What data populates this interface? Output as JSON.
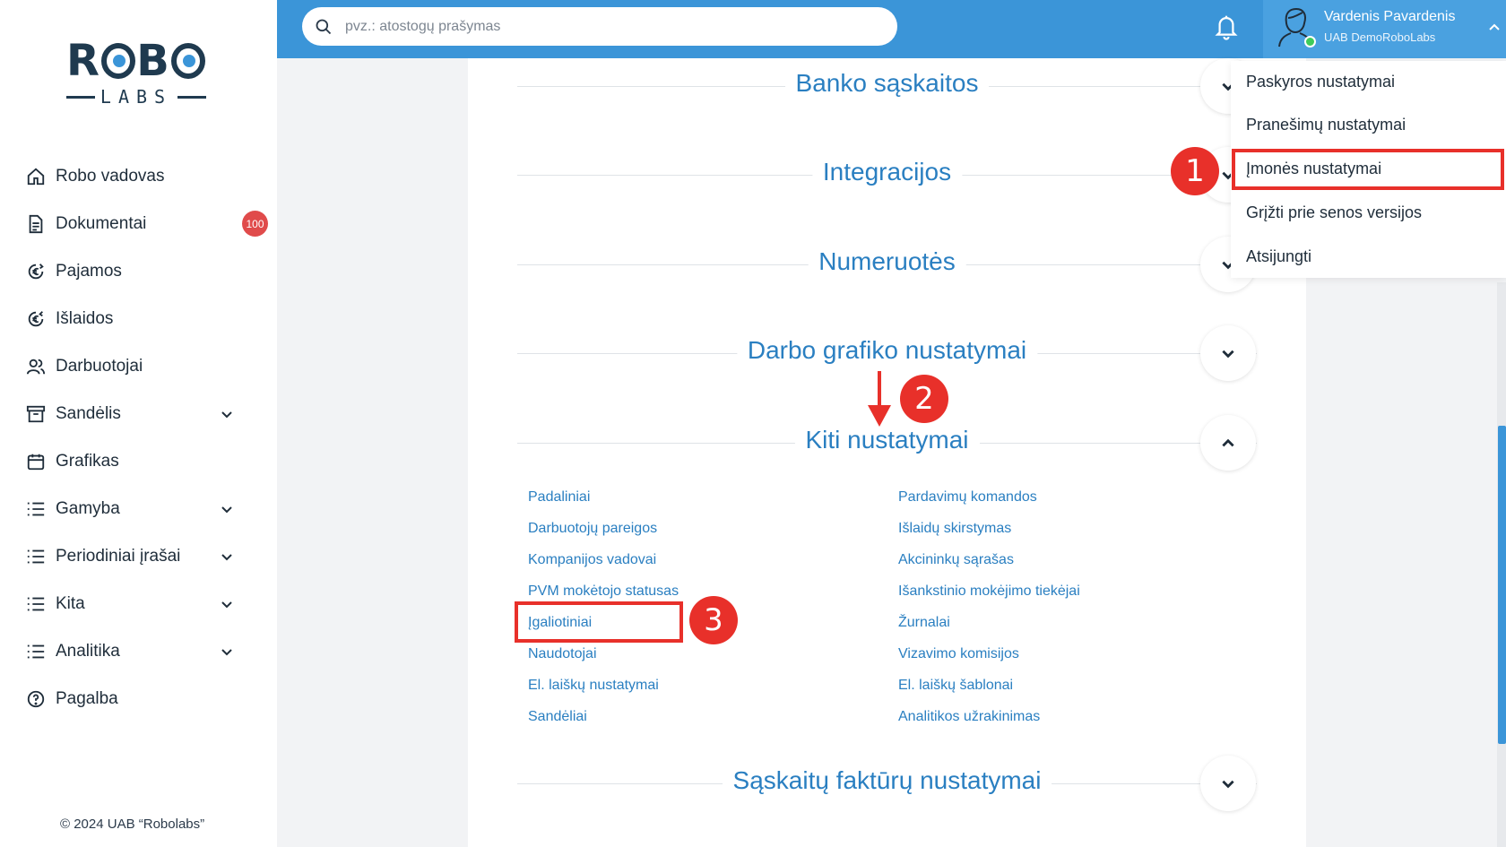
{
  "brand": {
    "logo_top_left": "R",
    "logo_top_mid": "B",
    "logo_bottom": "LABS"
  },
  "sidebar": {
    "items": [
      {
        "label": "Robo vadovas",
        "icon": "home-icon",
        "has_chevron": false
      },
      {
        "label": "Dokumentai",
        "icon": "document-icon",
        "badge": "100"
      },
      {
        "label": "Pajamos",
        "icon": "income-icon"
      },
      {
        "label": "Išlaidos",
        "icon": "expense-icon"
      },
      {
        "label": "Darbuotojai",
        "icon": "users-icon"
      },
      {
        "label": "Sandėlis",
        "icon": "archive-icon",
        "has_chevron": true
      },
      {
        "label": "Grafikas",
        "icon": "calendar-icon"
      },
      {
        "label": "Gamyba",
        "icon": "list-icon",
        "has_chevron": true
      },
      {
        "label": "Periodiniai įrašai",
        "icon": "list-icon",
        "has_chevron": true
      },
      {
        "label": "Kita",
        "icon": "list-icon",
        "has_chevron": true
      },
      {
        "label": "Analitika",
        "icon": "list-icon",
        "has_chevron": true
      },
      {
        "label": "Pagalba",
        "icon": "help-icon"
      }
    ],
    "copyright": "© 2024 UAB “Robolabs”"
  },
  "topbar": {
    "search_placeholder": "pvz.: atostogų prašymas",
    "user_name": "Vardenis Pavardenis",
    "user_company": "UAB DemoRoboLabs"
  },
  "dropdown": {
    "items": [
      "Paskyros nustatymai",
      "Pranešimų nustatymai",
      "Įmonės nustatymai",
      "Grįžti prie senos versijos",
      "Atsijungti"
    ]
  },
  "sections": {
    "banko": "Banko sąskaitos",
    "integracijos": "Integracijos",
    "numeruotes": "Numeruotės",
    "darbo": "Darbo grafiko nustatymai",
    "kiti": "Kiti nustatymai",
    "saskaitu": "Sąskaitų faktūrų nustatymai"
  },
  "links": {
    "left": [
      "Padaliniai",
      "Darbuotojų pareigos",
      "Kompanijos vadovai",
      "PVM mokėtojo statusas",
      "Įgaliotiniai",
      "Naudotojai",
      "El. laiškų nustatymai",
      "Sandėliai"
    ],
    "right": [
      "Pardavimų komandos",
      "Išlaidų skirstymas",
      "Akcininkų sąrašas",
      "Išankstinio mokėjimo tiekėjai",
      "Žurnalai",
      "Vizavimo komisijos",
      "El. laiškų šablonai",
      "Analitikos užrakinimas"
    ]
  },
  "annotations": {
    "step1": "1",
    "step2": "2",
    "step3": "3"
  },
  "colors": {
    "accent": "#3b95d8",
    "link": "#2a7fc1",
    "annotation": "#e8302a",
    "badge": "#e04b4b"
  }
}
